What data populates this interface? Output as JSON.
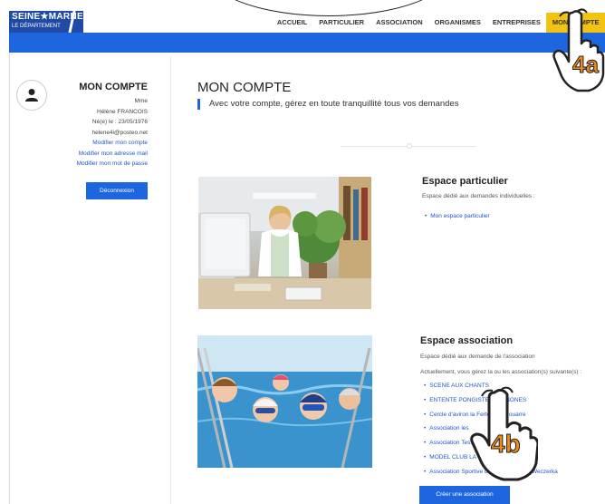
{
  "header": {
    "logo_line1": "SEINE★MARNE",
    "logo_line2": "LE DÉPARTEMENT",
    "nav": [
      "ACCUEIL",
      "PARTICULIER",
      "ASSOCIATION",
      "ORGANISMES",
      "ENTREPRISES",
      "MON COMPTE"
    ],
    "active_nav": "MON COMPTE"
  },
  "sidebar": {
    "title": "MON COMPTE",
    "civility": "Mme",
    "name": "Hélène FRANCOIS",
    "birth": "Né(e) le : 23/05/1976",
    "email": "helene4i@posteo.net",
    "link_account": "Modifier mon compte",
    "link_mail": "Modifier mon adresse mail",
    "link_password": "Modifier mon mot de passe",
    "logout": "Déconnexion"
  },
  "main": {
    "title": "MON COMPTE",
    "subtitle": "Avec votre compte, gérez en toute tranquillité tous vos demandes",
    "particulier": {
      "title": "Espace particulier",
      "desc": "Espace dédié aux demandes individuelles :",
      "items": [
        "Mon espace particulier"
      ]
    },
    "association": {
      "title": "Espace association",
      "desc": "Espace dédié aux demande de l'association",
      "desc2": "Actuellement, vous gérez la ou les association(s) suivante(s) :",
      "items": [
        "SCENE AUX CHANTS",
        "ENTENTE PONGISTE BOIGNONES",
        "Cercle d'aviron la Ferté sous Jouarre",
        "Association les",
        "Association Tessa",
        "MODEL CLUB LA SA",
        "Association Sportive du Collège Pierre Weczerka"
      ],
      "create_button": "Créer une association"
    }
  },
  "annotations": {
    "badge_a": "4a",
    "badge_b": "4b",
    "badge_color": "#f08a1c"
  }
}
